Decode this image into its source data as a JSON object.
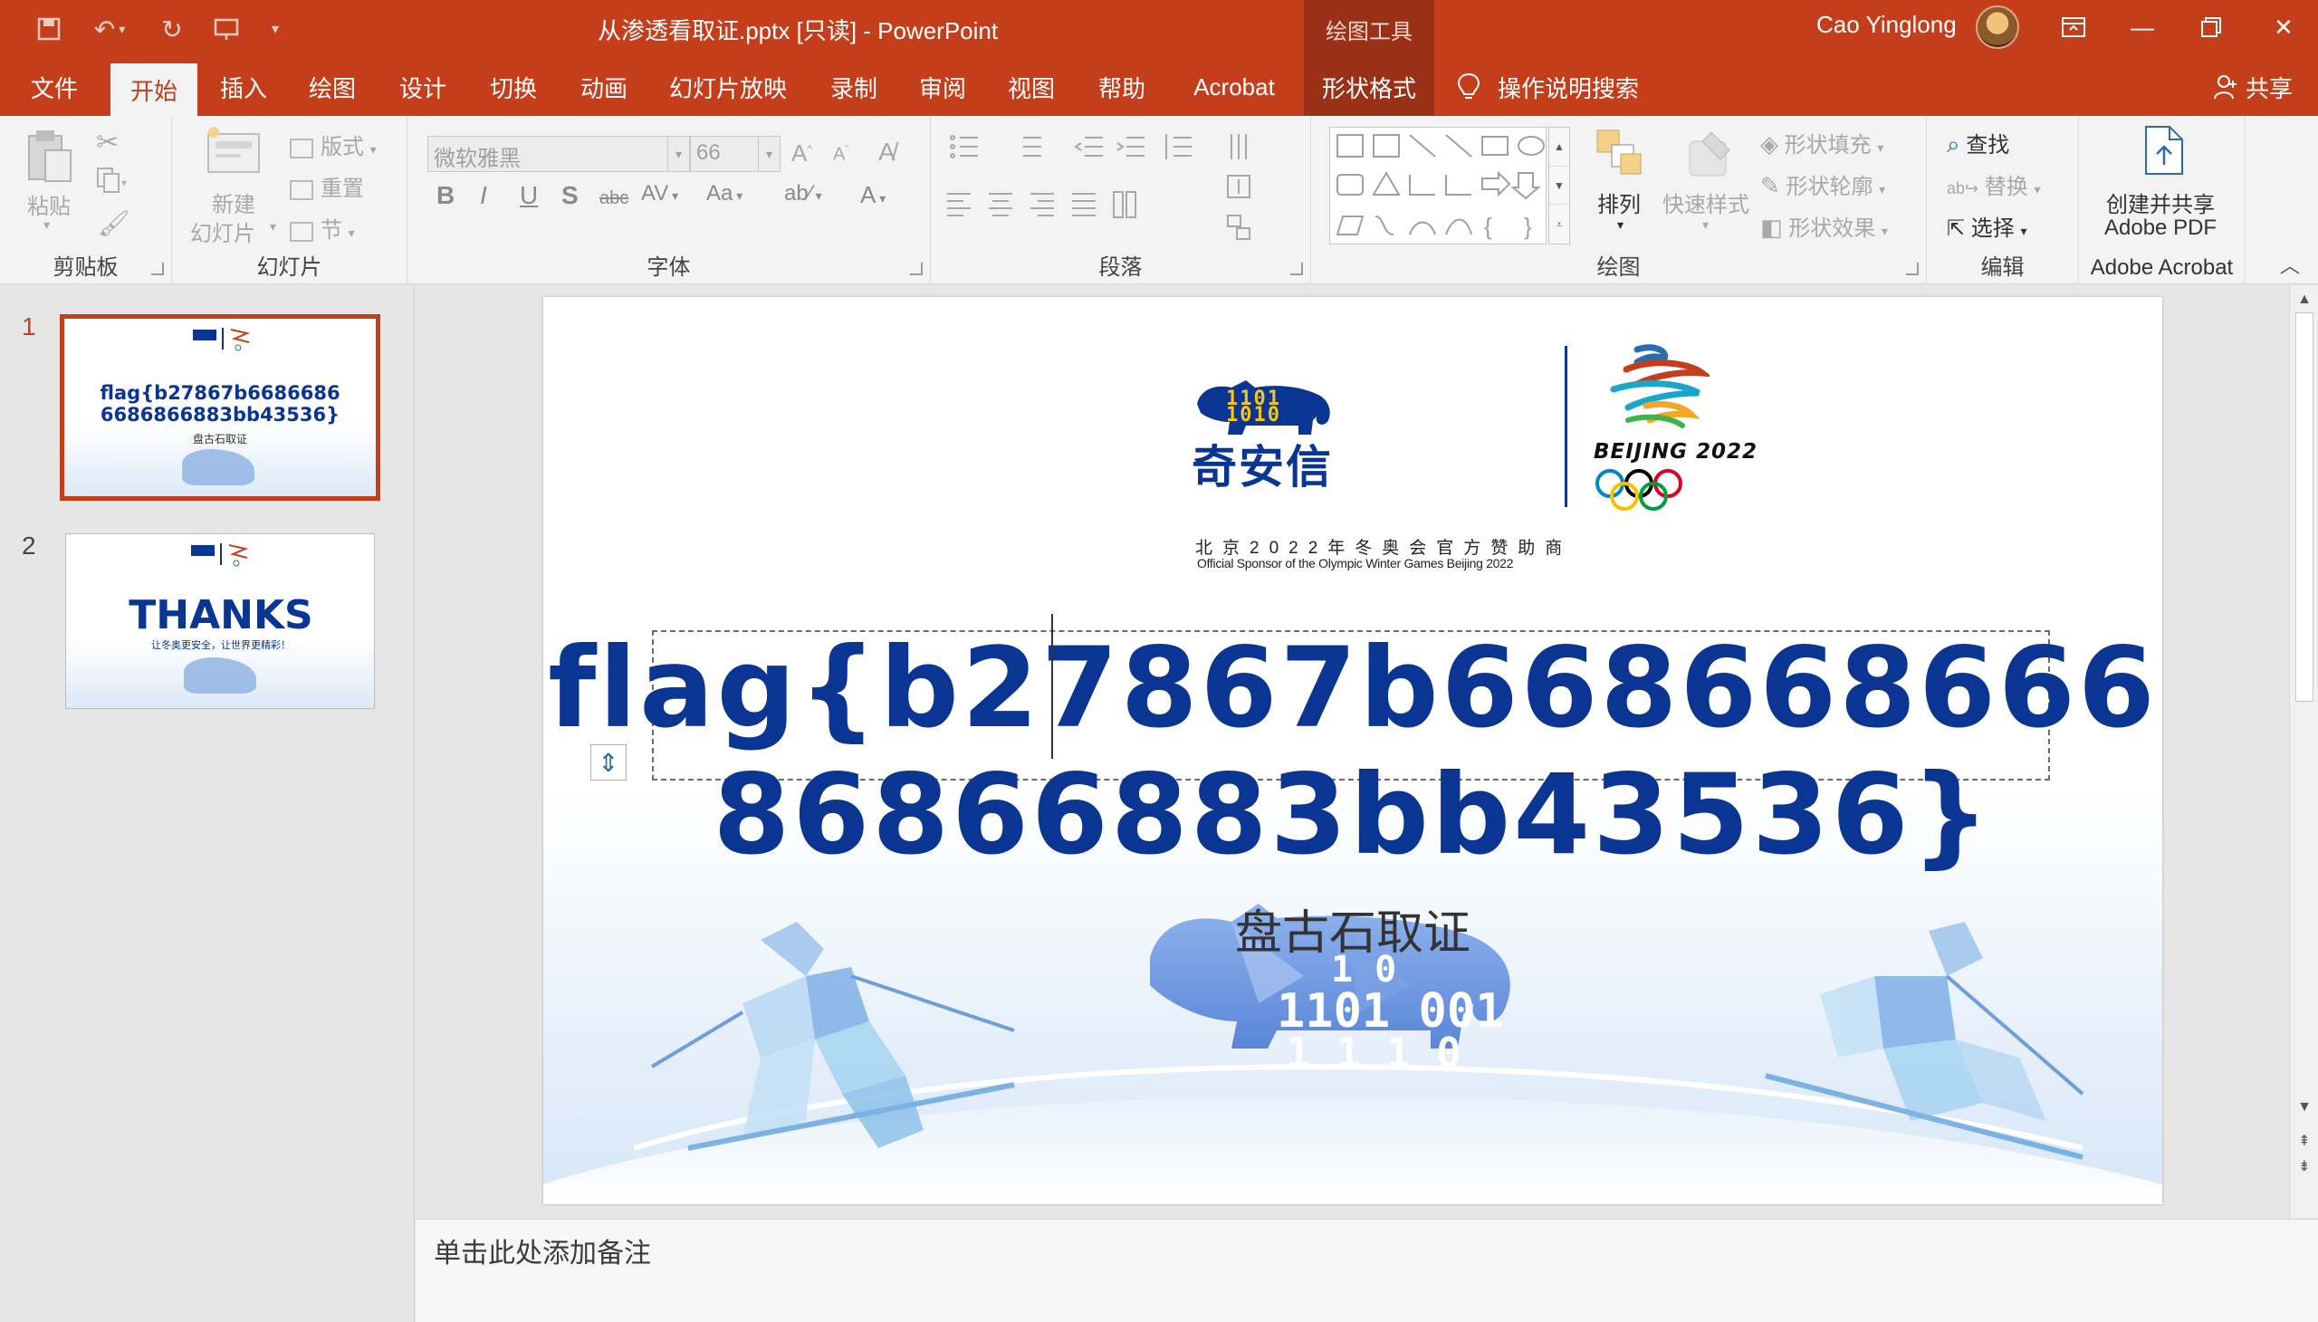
{
  "titlebar": {
    "doc_title": "从渗透看取证.pptx [只读]  -  PowerPoint",
    "context_tools": "绘图工具",
    "user_name": "Cao Yinglong"
  },
  "tabs": [
    {
      "label": "文件"
    },
    {
      "label": "开始"
    },
    {
      "label": "插入"
    },
    {
      "label": "绘图"
    },
    {
      "label": "设计"
    },
    {
      "label": "切换"
    },
    {
      "label": "动画"
    },
    {
      "label": "幻灯片放映"
    },
    {
      "label": "录制"
    },
    {
      "label": "审阅"
    },
    {
      "label": "视图"
    },
    {
      "label": "帮助"
    },
    {
      "label": "Acrobat"
    },
    {
      "label": "形状格式"
    }
  ],
  "tell_me": "操作说明搜索",
  "share": "共享",
  "ribbon": {
    "clipboard": {
      "paste": "粘贴",
      "label": "剪贴板"
    },
    "slides": {
      "new_slide_1": "新建",
      "new_slide_2": "幻灯片",
      "layout": "版式",
      "reset": "重置",
      "section": "节",
      "label": "幻灯片"
    },
    "font": {
      "font_name": "微软雅黑",
      "font_size": "66",
      "label": "字体",
      "aa": "Aa"
    },
    "paragraph": {
      "label": "段落"
    },
    "drawing": {
      "arrange": "排列",
      "quick_styles": "快速样式",
      "fill": "形状填充",
      "outline": "形状轮廓",
      "effects": "形状效果",
      "label": "绘图"
    },
    "editing": {
      "find": "查找",
      "replace": "替换",
      "select": "选择",
      "label": "编辑"
    },
    "acrobat": {
      "line1": "创建并共享",
      "line2": "Adobe PDF",
      "label": "Adobe Acrobat"
    }
  },
  "thumbnails": [
    {
      "number": "1",
      "text1": "flag{b27867b6686686",
      "text2": "6686866883bb43536}",
      "caption": "盘古石取证"
    },
    {
      "number": "2",
      "title": "THANKS",
      "sub": "让冬奥更安全，让世界更精彩！"
    }
  ],
  "slide": {
    "brand_cn": "奇安信",
    "brand_binary_1": "1101",
    "brand_binary_2": "1010",
    "beijing": "BEIJING 2022",
    "sponsor_cn": "北京2022年冬奥会官方赞助商",
    "sponsor_en": "Official Sponsor of the Olympic Winter Games Beijing 2022",
    "flag": "flag{b27867b66866866686866883bb43536}",
    "subtitle": "盘古石取证",
    "mascot_binary_1": "1 0",
    "mascot_binary_2": "1101 001",
    "mascot_binary_3": "1 1 1 0"
  },
  "notes_placeholder": "单击此处添加备注",
  "colors": {
    "accent": "#c43e1c",
    "flag_blue": "#0a3592"
  }
}
